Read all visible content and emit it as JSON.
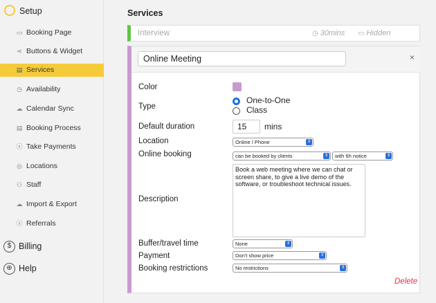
{
  "sidebar": {
    "header": "Setup",
    "items": [
      {
        "label": "Booking Page",
        "icon": "browser-icon"
      },
      {
        "label": "Buttons & Widget",
        "icon": "share-icon"
      },
      {
        "label": "Services",
        "icon": "services-icon"
      },
      {
        "label": "Availability",
        "icon": "clock-icon"
      },
      {
        "label": "Calendar Sync",
        "icon": "cloud-icon"
      },
      {
        "label": "Booking Process",
        "icon": "process-icon"
      },
      {
        "label": "Take Payments",
        "icon": "dollar-icon"
      },
      {
        "label": "Locations",
        "icon": "pin-icon"
      },
      {
        "label": "Staff",
        "icon": "people-icon"
      },
      {
        "label": "Import & Export",
        "icon": "cloud-icon"
      },
      {
        "label": "Referrals",
        "icon": "dollar-icon"
      }
    ],
    "billing": "Billing",
    "help": "Help",
    "active_color": "#f5cb3a"
  },
  "main": {
    "title": "Services",
    "interview": {
      "name": "Interview",
      "duration": "30mins",
      "visibility": "Hidden",
      "accent": "#5fc545"
    },
    "editor": {
      "name_value": "Online Meeting",
      "accent": "#c99ad0",
      "labels": {
        "color": "Color",
        "type": "Type",
        "default_duration": "Default duration",
        "location": "Location",
        "online_booking": "Online booking",
        "description": "Description",
        "buffer": "Buffer/travel time",
        "payment": "Payment",
        "restrictions": "Booking restrictions"
      },
      "type_options": [
        "One-to-One",
        "Class"
      ],
      "duration_value": "15",
      "duration_unit": "mins",
      "location_value": "Online / Phone",
      "online_booking_value": "can be booked by clients",
      "notice_value": "with 6h notice",
      "description_value": "Book a web meeting where we can chat or screen share, to give a live demo of the software, or troubleshoot technical issues.",
      "buffer_value": "None",
      "payment_value": "Don't show price",
      "restrictions_value": "No restrictions",
      "delete_label": "Delete",
      "close_label": "×"
    }
  }
}
